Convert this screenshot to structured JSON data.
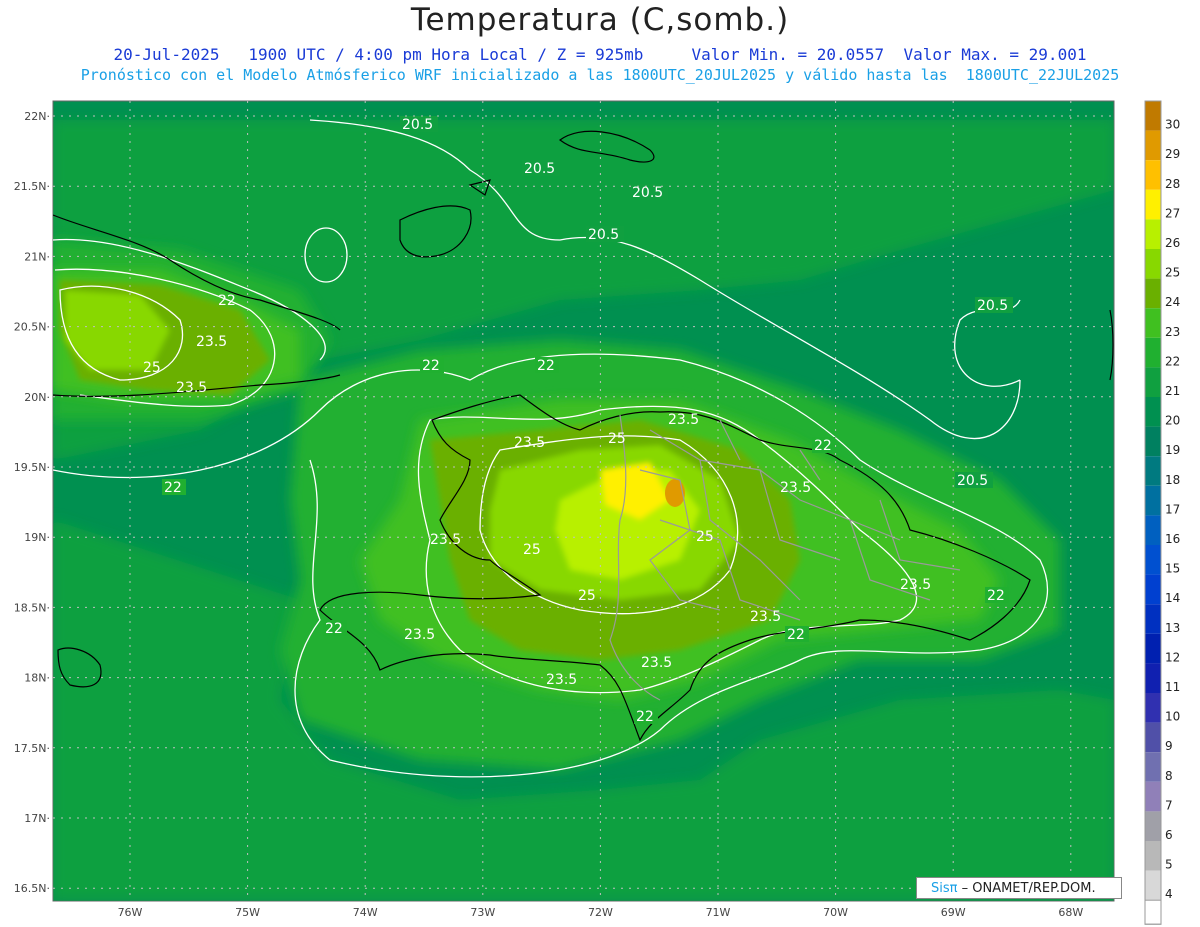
{
  "header": {
    "title": "Temperatura (C,somb.)",
    "date": "20-Jul-2025",
    "time": "1900 UTC / 4:00 pm Hora Local / Z = 925mb",
    "min": "Valor Min. = 20.0557",
    "max": "Valor Max. = 29.001",
    "subtitle": "Pronóstico con el Modelo Atmósferico WRF inicializado a las 1800UTC_20JUL2025 y válido hasta las  1800UTC_22JUL2025"
  },
  "axes": {
    "lat_labels": [
      "22N",
      "21.5N",
      "21N",
      "20.5N",
      "20N",
      "19.5N",
      "19N",
      "18.5N",
      "18N",
      "17.5N",
      "17N",
      "16.5N"
    ],
    "lon_labels": [
      "76W",
      "75W",
      "74W",
      "73W",
      "72W",
      "71W",
      "70W",
      "69W",
      "68W"
    ]
  },
  "colorbar": {
    "labels": [
      "30",
      "29",
      "28",
      "27",
      "26",
      "25",
      "24",
      "23",
      "22",
      "21",
      "20",
      "19",
      "18",
      "17",
      "16",
      "15",
      "14",
      "13",
      "12",
      "11",
      "10",
      "9",
      "8",
      "7",
      "6",
      "5",
      "4"
    ],
    "colors": [
      "#c07a00",
      "#e09a00",
      "#ffc000",
      "#fff000",
      "#b8f000",
      "#88d800",
      "#6ab000",
      "#40c020",
      "#20b030",
      "#10a040",
      "#009050",
      "#008060",
      "#007a80",
      "#0070a0",
      "#0060c0",
      "#0050d0",
      "#0040d0",
      "#0030c0",
      "#0020b0",
      "#1020b0",
      "#3030b0",
      "#5050a8",
      "#7070b0",
      "#9080b8",
      "#a0a0a8",
      "#b8b8b8",
      "#d8d8d8"
    ]
  },
  "contour_labels": [
    "20.5",
    "22",
    "23.5",
    "25"
  ],
  "credit": {
    "brand": "Sisπ",
    "text": "– ONAMET/REP.DOM."
  }
}
